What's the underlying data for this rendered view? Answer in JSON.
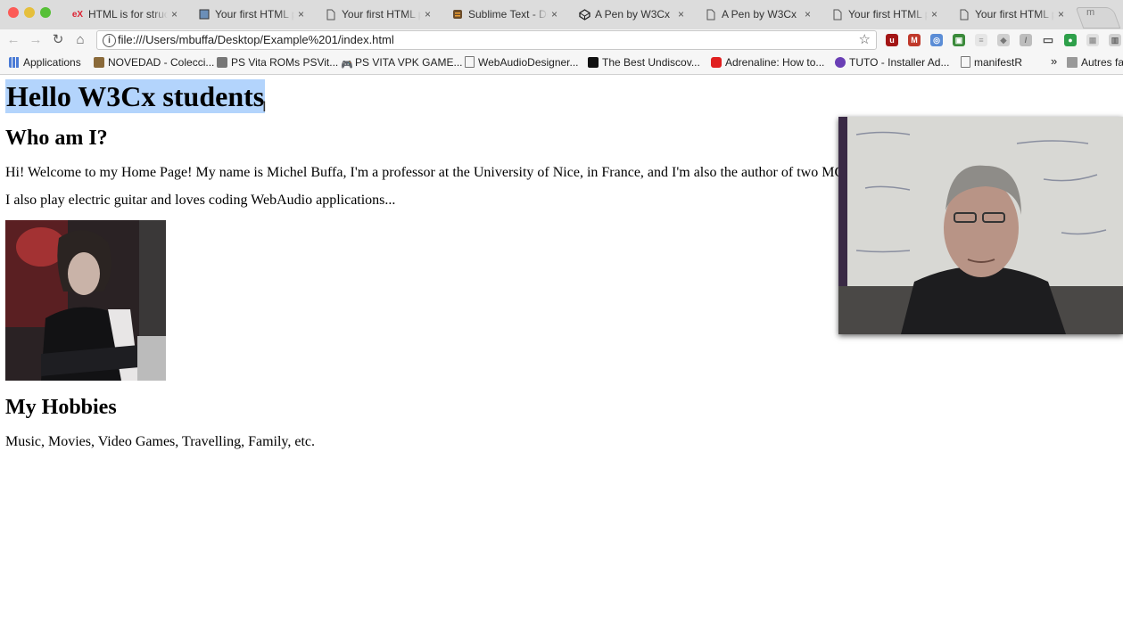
{
  "browser": {
    "tabs": [
      {
        "label": "HTML is for struct",
        "favicon": "edx-icon",
        "active": false
      },
      {
        "label": "Your first HTML p",
        "favicon": "codepen-page-icon",
        "active": false
      },
      {
        "label": "Your first HTML p",
        "favicon": "page-icon",
        "active": false
      },
      {
        "label": "Sublime Text - Do",
        "favicon": "sublime-icon",
        "active": false
      },
      {
        "label": "A Pen by W3Cx",
        "favicon": "codepen-icon",
        "active": false
      },
      {
        "label": "A Pen by W3Cx",
        "favicon": "page-icon",
        "active": false
      },
      {
        "label": "Your first HTML p",
        "favicon": "page-icon",
        "active": false
      },
      {
        "label": "Your first HTML p",
        "favicon": "page-icon",
        "active": true
      }
    ],
    "new_tab_label": "m",
    "close_glyph": "×",
    "url": "file:///Users/mbuffa/Desktop/Example%201/index.html",
    "bookmarks": [
      {
        "label": "Applications",
        "icon": "apps-grid-icon"
      },
      {
        "label": "NOVEDAD - Colecci...",
        "icon": "bookmark-favicon"
      },
      {
        "label": "PS Vita ROMs PSVit...",
        "icon": "bookmark-favicon"
      },
      {
        "label": "PS VITA VPK GAME...",
        "icon": "gamepad-icon"
      },
      {
        "label": "WebAudioDesigner...",
        "icon": "page-icon"
      },
      {
        "label": "The Best Undiscov...",
        "icon": "bookmark-favicon"
      },
      {
        "label": "Adrenaline: How to...",
        "icon": "youtube-icon"
      },
      {
        "label": "TUTO - Installer Ad...",
        "icon": "bookmark-favicon"
      },
      {
        "label": "manifestR",
        "icon": "page-icon"
      }
    ],
    "bookmarks_overflow": "»",
    "other_bookmarks": "Autres fa",
    "colors": {
      "tabstrip": "#dcdcdc",
      "selection": "#b3d4fc"
    }
  },
  "page": {
    "h1": "Hello W3Cx students",
    "h2_about": "Who am I?",
    "p_intro": "Hi! Welcome to my Home Page! My name is Michel Buffa, I'm a professor at the University of Nice, in France, and I'm also the author of two MOOCS about HTML",
    "p_hobby_line": "I also play electric guitar and loves coding WebAudio applications...",
    "h2_hobbies": "My Hobbies",
    "p_hobbies": "Music, Movies, Video Games, Travelling, Family, etc."
  }
}
